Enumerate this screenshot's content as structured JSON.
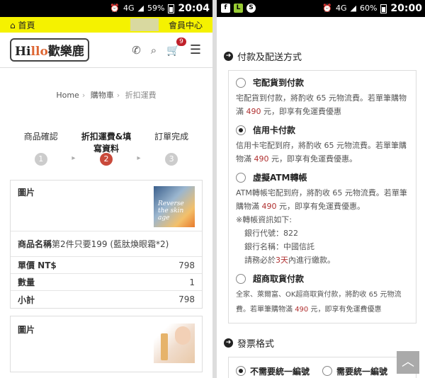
{
  "left_status": {
    "indicators": [
      "⏰",
      "4G"
    ],
    "battery": "59%",
    "time": "20:04"
  },
  "right_status": {
    "apps": [
      "f",
      "L",
      "S"
    ],
    "indicators": [
      "⏰",
      "4G"
    ],
    "battery": "60%",
    "time": "20:00"
  },
  "topbar": {
    "home_label": "首頁",
    "member_label": "會員中心"
  },
  "brand": {
    "logo_pre": "Hi",
    "logo_mid": "llo",
    "logo_cn": "歡樂鹿",
    "cart_count": "9"
  },
  "breadcrumb": [
    "Home",
    "購物車",
    "折扣運費"
  ],
  "steps": [
    {
      "label": "商品確認",
      "num": "1"
    },
    {
      "label": "折扣運費&填寫資料",
      "num": "2"
    },
    {
      "label": "訂單完成",
      "num": "3"
    }
  ],
  "product1": {
    "image_label": "圖片",
    "image_text": "Reverse the skin age",
    "name_label": "商品名稱",
    "name_value": "第2件只要199 (藍肽煥眼霜*2)",
    "price_label": "單價 NT$",
    "price_value": "798",
    "qty_label": "數量",
    "qty_value": "1",
    "subtotal_label": "小計",
    "subtotal_value": "798"
  },
  "product2": {
    "image_label": "圖片"
  },
  "payment": {
    "title": "付款及配送方式",
    "options": [
      {
        "label": "宅配貨到付款",
        "desc_1": "宅配貨到付款，將酌收 65 元物流費。若單筆購物滿 ",
        "amount": "490",
        "desc_2": " 元，即享有免運費優惠"
      },
      {
        "label": "信用卡付款",
        "desc_1": "信用卡宅配到府，將酌收 65 元物流費。若單筆購物滿 ",
        "amount": "490",
        "desc_2": " 元，即享有免運費優惠。"
      },
      {
        "label": "虛擬ATM轉帳",
        "desc_1": "ATM轉帳宅配到府，將酌收 65 元物流費。若單筆購物滿 ",
        "amount": "490",
        "desc_2": " 元，即享有免運費優惠。",
        "info_title": "※轉帳資訊如下:",
        "bank_code": "銀行代號：822",
        "bank_name": "銀行名稱：中國信託",
        "deadline_1": "請務必於",
        "deadline_red": "3天",
        "deadline_2": "內進行繳款。"
      },
      {
        "label": "超商取貨付款",
        "desc_1": "全家、萊爾富、OK超商取貨付款，將酌收 65 元物流費。若單筆購物滿 ",
        "amount": "490",
        "desc_2": " 元，即享有免運費優惠"
      }
    ],
    "selected": "信用卡付款"
  },
  "invoice": {
    "title": "發票格式",
    "option_a": "不需要統一編號",
    "option_b": "需要統一編號"
  },
  "scroll_top_icon": "chevron-up"
}
